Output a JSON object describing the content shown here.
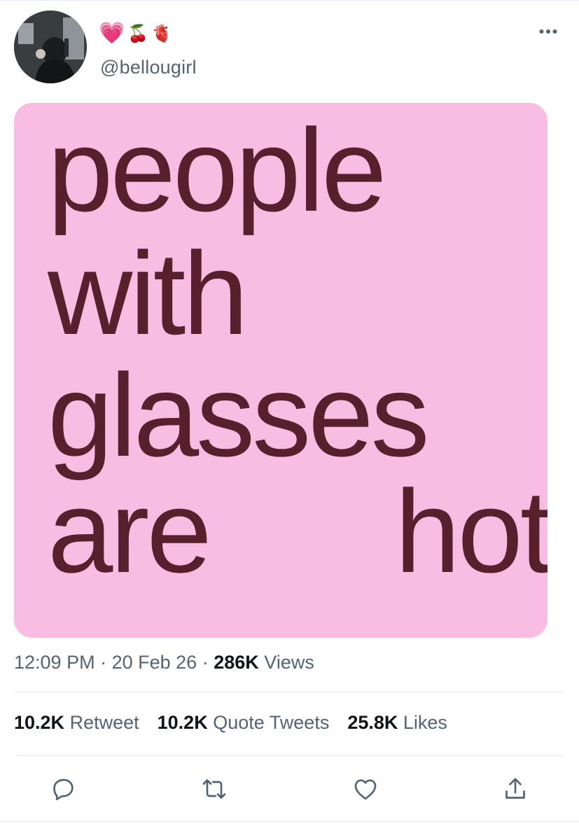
{
  "author": {
    "emojis": [
      "💗",
      "🍒",
      "🫀"
    ],
    "handle": "@bellougirl",
    "avatar": "avatar-photo"
  },
  "header": {
    "more_icon": "more-horizontal-icon"
  },
  "media": {
    "background_color": "#f9bde3",
    "text_color": "#5a1f2c",
    "words": [
      "people",
      "with",
      "glasses",
      "are",
      "hot"
    ]
  },
  "meta": {
    "time": "12:09 PM",
    "separator": "·",
    "date": "20 Feb 26",
    "views_count": "286K",
    "views_label": "Views"
  },
  "stats": {
    "retweets_count": "10.2K",
    "retweets_label": "Retweet",
    "quotes_count": "10.2K",
    "quotes_label": "Quote Tweets",
    "likes_count": "25.8K",
    "likes_label": "Likes"
  },
  "actions": {
    "reply_icon": "reply-icon",
    "retweet_icon": "retweet-icon",
    "like_icon": "like-icon",
    "share_icon": "share-icon",
    "icon_color": "#536471"
  }
}
